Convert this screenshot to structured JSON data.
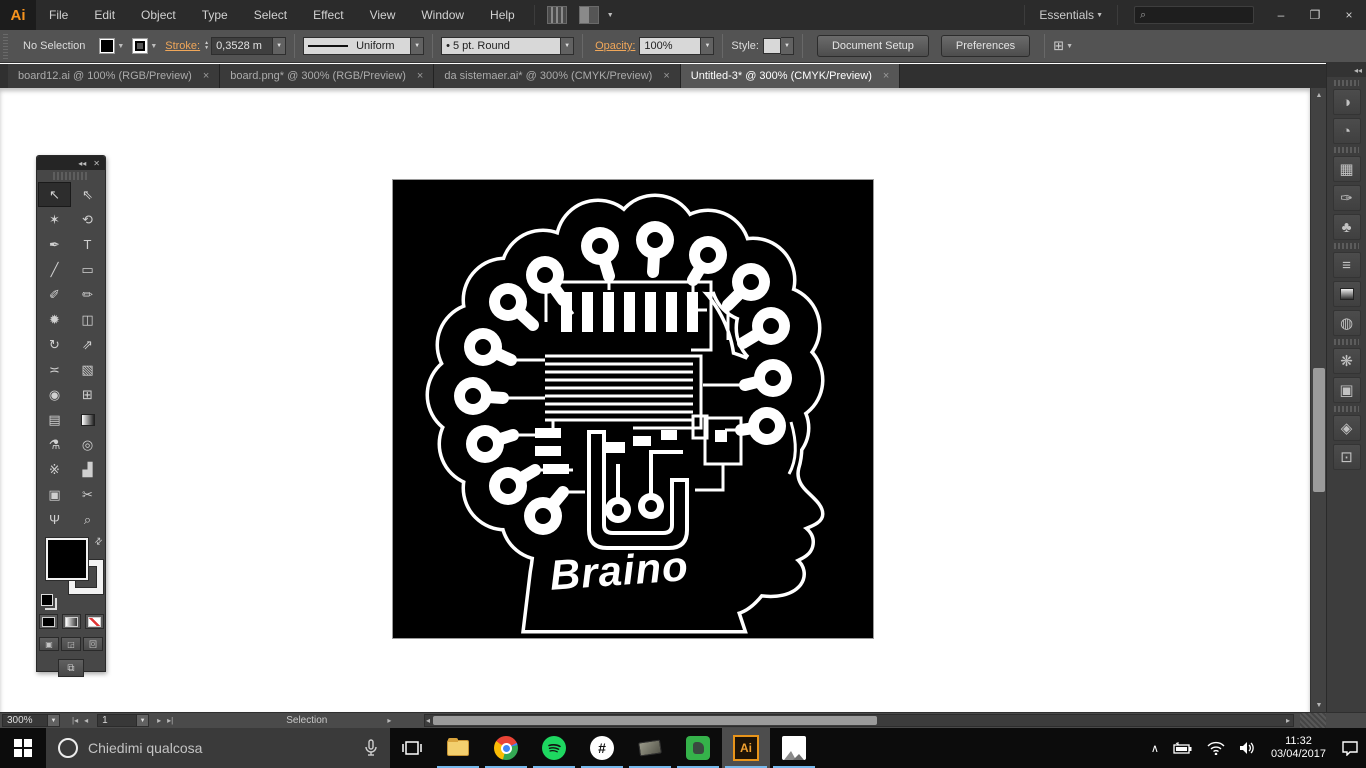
{
  "titlebar": {
    "app_logo": "Ai",
    "menus": [
      {
        "label": "File"
      },
      {
        "label": "Edit"
      },
      {
        "label": "Object"
      },
      {
        "label": "Type"
      },
      {
        "label": "Select"
      },
      {
        "label": "Effect"
      },
      {
        "label": "View"
      },
      {
        "label": "Window"
      },
      {
        "label": "Help"
      }
    ],
    "workspace": "Essentials",
    "search_glyph": "⌕",
    "window": {
      "minimize": "–",
      "restore": "❐",
      "close": "×"
    }
  },
  "controlbar": {
    "selection_status": "No Selection",
    "stroke_label": "Stroke:",
    "stroke_value": "0,3528 m",
    "variable_width_profile": "Uniform",
    "brush_definition": "•  5 pt. Round",
    "opacity_label": "Opacity:",
    "opacity_value": "100%",
    "style_label": "Style:",
    "document_setup_label": "Document Setup",
    "preferences_label": "Preferences"
  },
  "tabs": [
    {
      "title": "board12.ai @ 100% (RGB/Preview)",
      "close": "×"
    },
    {
      "title": "board.png* @ 300% (RGB/Preview)",
      "close": "×"
    },
    {
      "title": "da sistemaer.ai* @ 300% (CMYK/Preview)",
      "close": "×"
    },
    {
      "title": "Untitled-3* @ 300% (CMYK/Preview)",
      "close": "×"
    }
  ],
  "toolbar": {
    "collapse_glyph": "◂◂",
    "close_glyph": "✕",
    "tools": [
      {
        "name": "selection",
        "glyph": "↖"
      },
      {
        "name": "direct-selection",
        "glyph": "⇖"
      },
      {
        "name": "magic-wand",
        "glyph": "✶"
      },
      {
        "name": "lasso",
        "glyph": "⟲"
      },
      {
        "name": "pen",
        "glyph": "✒"
      },
      {
        "name": "type",
        "glyph": "T"
      },
      {
        "name": "line-segment",
        "glyph": "╱"
      },
      {
        "name": "rectangle",
        "glyph": "▭"
      },
      {
        "name": "paintbrush",
        "glyph": "✐"
      },
      {
        "name": "pencil",
        "glyph": "✏"
      },
      {
        "name": "blob-brush",
        "glyph": "✹"
      },
      {
        "name": "eraser",
        "glyph": "◫"
      },
      {
        "name": "rotate",
        "glyph": "↻"
      },
      {
        "name": "scale",
        "glyph": "⇗"
      },
      {
        "name": "width",
        "glyph": "≍"
      },
      {
        "name": "free-transform",
        "glyph": "▧"
      },
      {
        "name": "shape-builder",
        "glyph": "◉"
      },
      {
        "name": "perspective-grid",
        "glyph": "⊞"
      },
      {
        "name": "mesh",
        "glyph": "▤"
      },
      {
        "name": "gradient",
        "glyph": ""
      },
      {
        "name": "eyedropper",
        "glyph": "⚗"
      },
      {
        "name": "blend",
        "glyph": "◎"
      },
      {
        "name": "symbol-sprayer",
        "glyph": "※"
      },
      {
        "name": "column-graph",
        "glyph": "▟"
      },
      {
        "name": "artboard",
        "glyph": "▣"
      },
      {
        "name": "slice",
        "glyph": "✂"
      },
      {
        "name": "hand",
        "glyph": "Ψ"
      },
      {
        "name": "zoom",
        "glyph": "⌕"
      }
    ]
  },
  "artwork": {
    "title": "Braino"
  },
  "dock": {
    "collapse_glyph": "◂◂",
    "panels": [
      {
        "name": "color",
        "glyph": "◑"
      },
      {
        "name": "color-guide",
        "glyph": "◔"
      },
      {
        "name": "swatches",
        "glyph": "▦"
      },
      {
        "name": "brushes",
        "glyph": "✑"
      },
      {
        "name": "symbols",
        "glyph": "♣"
      },
      {
        "name": "stroke",
        "glyph": "≡"
      },
      {
        "name": "gradient",
        "glyph": ""
      },
      {
        "name": "transparency",
        "glyph": "◍"
      },
      {
        "name": "appearance",
        "glyph": "❋"
      },
      {
        "name": "graphic-styles",
        "glyph": "▣"
      },
      {
        "name": "layers",
        "glyph": "◈"
      },
      {
        "name": "artboards",
        "glyph": "⊡"
      }
    ]
  },
  "statusbar": {
    "zoom_level": "300%",
    "first_glyph": "|◂",
    "prev_glyph": "◂",
    "artboard_number": "1",
    "next_glyph": "▸",
    "last_glyph": "▸|",
    "status_text": "Selection",
    "pane_arrow": "▸",
    "hscroll_left": "◂",
    "hscroll_right": "▸",
    "vscroll_up": "▲",
    "vscroll_down": "▼"
  },
  "taskbar": {
    "search_placeholder": "Chiedimi qualcosa",
    "apps": [
      {
        "name": "file-explorer"
      },
      {
        "name": "chrome"
      },
      {
        "name": "spotify"
      },
      {
        "name": "hash-app",
        "glyph": "#"
      },
      {
        "name": "utility-app"
      },
      {
        "name": "evernote"
      },
      {
        "name": "illustrator",
        "label": "Ai",
        "active": true
      },
      {
        "name": "photos"
      }
    ],
    "tray_chevron": "∧",
    "clock_time": "11:32",
    "clock_date": "03/04/2017"
  },
  "colors": {
    "accent_orange": "#f7931e",
    "control_orange": "#f0a75a",
    "taskbar_underline": "#76b9ed",
    "spotify_green": "#1ed760",
    "evernote_green": "#35b24a",
    "artboard_bg": "#000000",
    "artwork_stroke": "#ffffff"
  }
}
